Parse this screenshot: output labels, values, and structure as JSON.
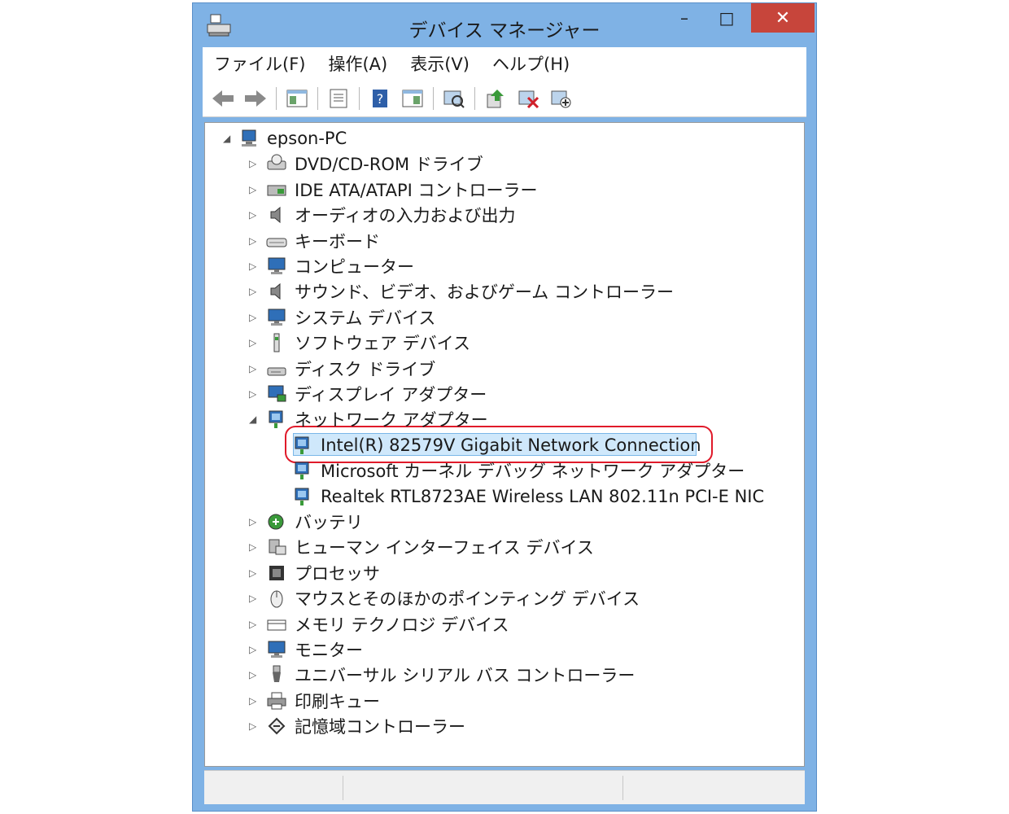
{
  "window": {
    "title": "デバイス マネージャー",
    "minimize_glyph": "–",
    "maximize_glyph": "□",
    "close_glyph": "✕"
  },
  "menu": [
    "ファイル(F)",
    "操作(A)",
    "表示(V)",
    "ヘルプ(H)"
  ],
  "toolbar_icons": [
    "back-arrow-icon",
    "forward-arrow-icon",
    "show-hide-tree-icon",
    "properties-icon",
    "help-icon",
    "action-pane-icon",
    "scan-hardware-icon",
    "update-driver-icon",
    "uninstall-icon",
    "add-legacy-icon"
  ],
  "tree": {
    "root": "epson-PC",
    "categories": [
      "DVD/CD-ROM ドライブ",
      "IDE ATA/ATAPI コントローラー",
      "オーディオの入力および出力",
      "キーボード",
      "コンピューター",
      "サウンド、ビデオ、およびゲーム コントローラー",
      "システム デバイス",
      "ソフトウェア デバイス",
      "ディスク ドライブ",
      "ディスプレイ アダプター",
      "ネットワーク アダプター"
    ],
    "network_children": [
      "Intel(R) 82579V Gigabit Network Connection",
      "Microsoft カーネル デバッグ ネットワーク アダプター",
      "Realtek RTL8723AE Wireless LAN 802.11n PCI-E NIC"
    ],
    "categories_after": [
      "バッテリ",
      "ヒューマン インターフェイス デバイス",
      "プロセッサ",
      "マウスとそのほかのポインティング デバイス",
      "メモリ テクノロジ デバイス",
      "モニター",
      "ユニバーサル シリアル バス コントローラー",
      "印刷キュー",
      "記憶域コントローラー"
    ]
  },
  "colors": {
    "title_bar": "#7fb2e5",
    "close_button": "#c7453b",
    "selection": "#cfe8fb",
    "highlight_ring": "#e01a2a"
  }
}
